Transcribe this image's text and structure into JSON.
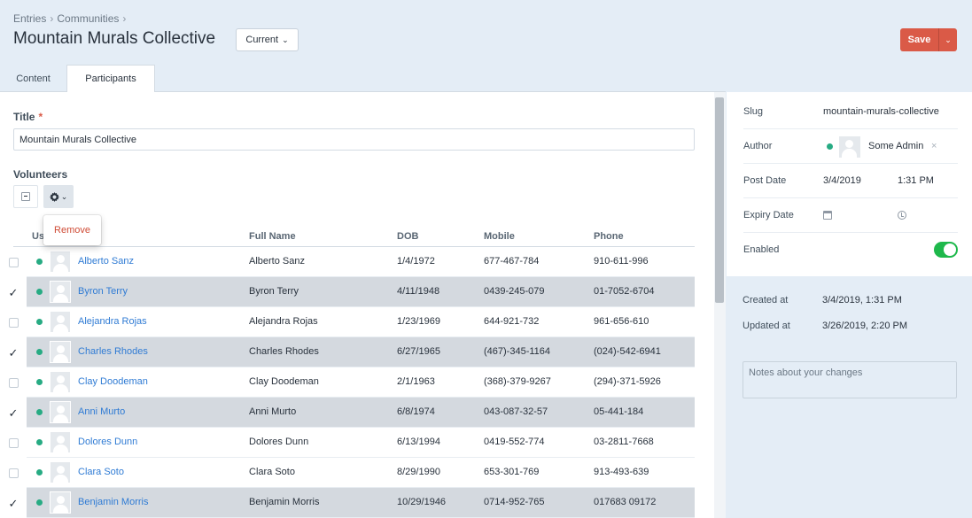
{
  "breadcrumb": [
    "Entries",
    "Communities"
  ],
  "breadcrumb_sep": "›",
  "page_title": "Mountain Murals Collective",
  "site_selector": {
    "label": "Current"
  },
  "save": {
    "label": "Save"
  },
  "tabs": [
    {
      "label": "Content",
      "active": false
    },
    {
      "label": "Participants",
      "active": true
    }
  ],
  "fields": {
    "title_label": "Title",
    "required_mark": "*",
    "title_value": "Mountain Murals Collective",
    "volunteers_label": "Volunteers"
  },
  "actions_menu": {
    "remove_label": "Remove"
  },
  "table": {
    "columns": {
      "user": "User",
      "full_name": "Full Name",
      "dob": "DOB",
      "mobile": "Mobile",
      "phone": "Phone"
    },
    "rows": [
      {
        "selected": false,
        "user": "Alberto Sanz",
        "full_name": "Alberto Sanz",
        "dob": "1/4/1972",
        "mobile": "677-467-784",
        "phone": "910-611-996"
      },
      {
        "selected": true,
        "user": "Byron Terry",
        "full_name": "Byron Terry",
        "dob": "4/11/1948",
        "mobile": "0439-245-079",
        "phone": "01-7052-6704"
      },
      {
        "selected": false,
        "user": "Alejandra Rojas",
        "full_name": "Alejandra Rojas",
        "dob": "1/23/1969",
        "mobile": "644-921-732",
        "phone": "961-656-610"
      },
      {
        "selected": true,
        "user": "Charles Rhodes",
        "full_name": "Charles Rhodes",
        "dob": "6/27/1965",
        "mobile": "(467)-345-1164",
        "phone": "(024)-542-6941"
      },
      {
        "selected": false,
        "user": "Clay Doodeman",
        "full_name": "Clay Doodeman",
        "dob": "2/1/1963",
        "mobile": "(368)-379-9267",
        "phone": "(294)-371-5926"
      },
      {
        "selected": true,
        "user": "Anni Murto",
        "full_name": "Anni Murto",
        "dob": "6/8/1974",
        "mobile": "043-087-32-57",
        "phone": "05-441-184"
      },
      {
        "selected": false,
        "user": "Dolores Dunn",
        "full_name": "Dolores Dunn",
        "dob": "6/13/1994",
        "mobile": "0419-552-774",
        "phone": "03-2811-7668"
      },
      {
        "selected": false,
        "user": "Clara Soto",
        "full_name": "Clara Soto",
        "dob": "8/29/1990",
        "mobile": "653-301-769",
        "phone": "913-493-639"
      },
      {
        "selected": true,
        "user": "Benjamin Morris",
        "full_name": "Benjamin Morris",
        "dob": "10/29/1946",
        "mobile": "0714-952-765",
        "phone": "017683 09172"
      }
    ]
  },
  "meta": {
    "slug_label": "Slug",
    "slug": "mountain-murals-collective",
    "author_label": "Author",
    "author": "Some Admin",
    "author_remove": "×",
    "post_date_label": "Post Date",
    "post_date": "3/4/2019",
    "post_time": "1:31 PM",
    "expiry_date_label": "Expiry Date",
    "enabled_label": "Enabled",
    "enabled": true,
    "created_label": "Created at",
    "created": "3/4/2019, 1:31 PM",
    "updated_label": "Updated at",
    "updated": "3/26/2019, 2:20 PM"
  },
  "notes": {
    "placeholder": "Notes about your changes"
  },
  "colors": {
    "accent": "#da5a47",
    "link": "#2f7bd4",
    "status": "#27ab83",
    "toggle": "#1eb84b",
    "bg": "#e4edf6"
  },
  "icons": {
    "site_chevron": "chevron-down-icon",
    "actions": "gear-icon",
    "calendar": "calendar-icon",
    "clock": "clock-icon"
  }
}
